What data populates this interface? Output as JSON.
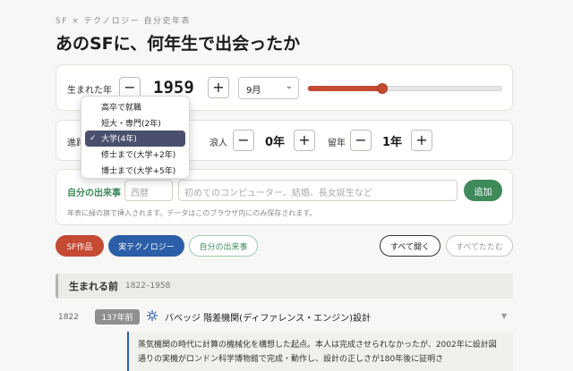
{
  "header": {
    "eyebrow": "SF × テクノロジー 自分史年表",
    "title": "あのSFに、何年生で出会ったか"
  },
  "birth": {
    "label": "生まれた年",
    "minus": "−",
    "plus": "+",
    "year": "1959",
    "month": "9月",
    "chevron": "⌄",
    "slider_value_fraction": 0.38
  },
  "path": {
    "label": "進路",
    "options": [
      "高卒で就職",
      "短大・専門(2年)",
      "大学(4年)",
      "修士まで(大学+2年)",
      "博士まで(大学+5年)"
    ],
    "selected_check": "✓",
    "ronin_label": "浪人",
    "ronin_value": "0年",
    "ryunen_label": "留年",
    "ryunen_value": "1年",
    "minus": "−",
    "plus": "+"
  },
  "my_events": {
    "label": "自分の出来事",
    "year_placeholder": "西暦",
    "text_placeholder": "初めてのコンピューター、結婚、長女誕生など",
    "add_label": "追加",
    "hint": "年表に緑の旗で挿入されます。データはこのブラウザ内にのみ保存されます。"
  },
  "filters": {
    "sf": "SF作品",
    "tech": "実テクノロジー",
    "mine": "自分の出来事",
    "expand_all": "すべて開く",
    "collapse_all": "すべてたたむ"
  },
  "colors": {
    "sf": "#c44a33",
    "tech": "#2c5ea8",
    "mine": "#3e8a5a"
  },
  "timeline": {
    "era_title": "生まれる前",
    "era_range": "1822–1958",
    "event": {
      "year": "1822",
      "ago": "137年前",
      "icon": "gear-icon",
      "title": "バベッジ 階差機関(ディファレンス・エンジン)設計",
      "caret": "▼",
      "detail": "蒸気機関の時代に計算の機械化を構想した起点。本人は完成させられなかったが、2002年に設計図通りの実機がロンドン科学博物館で完成・動作し、設計の正しさが180年後に証明さ"
    }
  }
}
